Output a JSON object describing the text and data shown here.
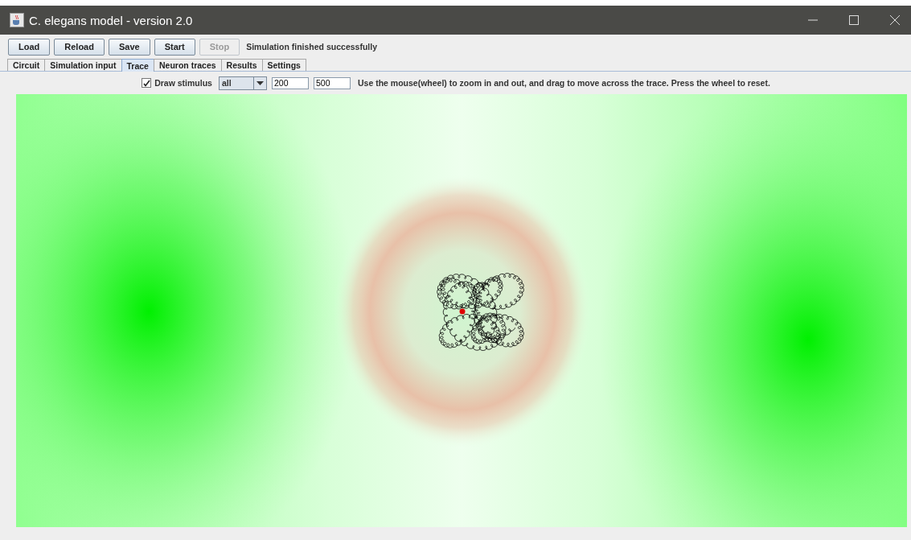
{
  "window": {
    "title": "C. elegans model - version 2.0"
  },
  "buttons": [
    {
      "label": "Load",
      "disabled": false
    },
    {
      "label": "Reload",
      "disabled": false
    },
    {
      "label": "Save",
      "disabled": false
    },
    {
      "label": "Start",
      "disabled": false
    },
    {
      "label": "Stop",
      "disabled": true
    }
  ],
  "status": "Simulation finished successfully",
  "tabs": [
    {
      "label": "Circuit",
      "selected": false
    },
    {
      "label": "Simulation input",
      "selected": false
    },
    {
      "label": "Trace",
      "selected": true
    },
    {
      "label": "Neuron traces",
      "selected": false
    },
    {
      "label": "Results",
      "selected": false
    },
    {
      "label": "Settings",
      "selected": false
    }
  ],
  "trace_toolbar": {
    "draw_stimulus": {
      "label": "Draw stimulus",
      "checked": true
    },
    "neuron_dropdown": {
      "value": "all"
    },
    "from_field": {
      "value": "200"
    },
    "to_field": {
      "value": "500"
    },
    "hint": "Use the mouse(wheel) to zoom in and out, and drag to move across the trace. Press the wheel to reset."
  }
}
